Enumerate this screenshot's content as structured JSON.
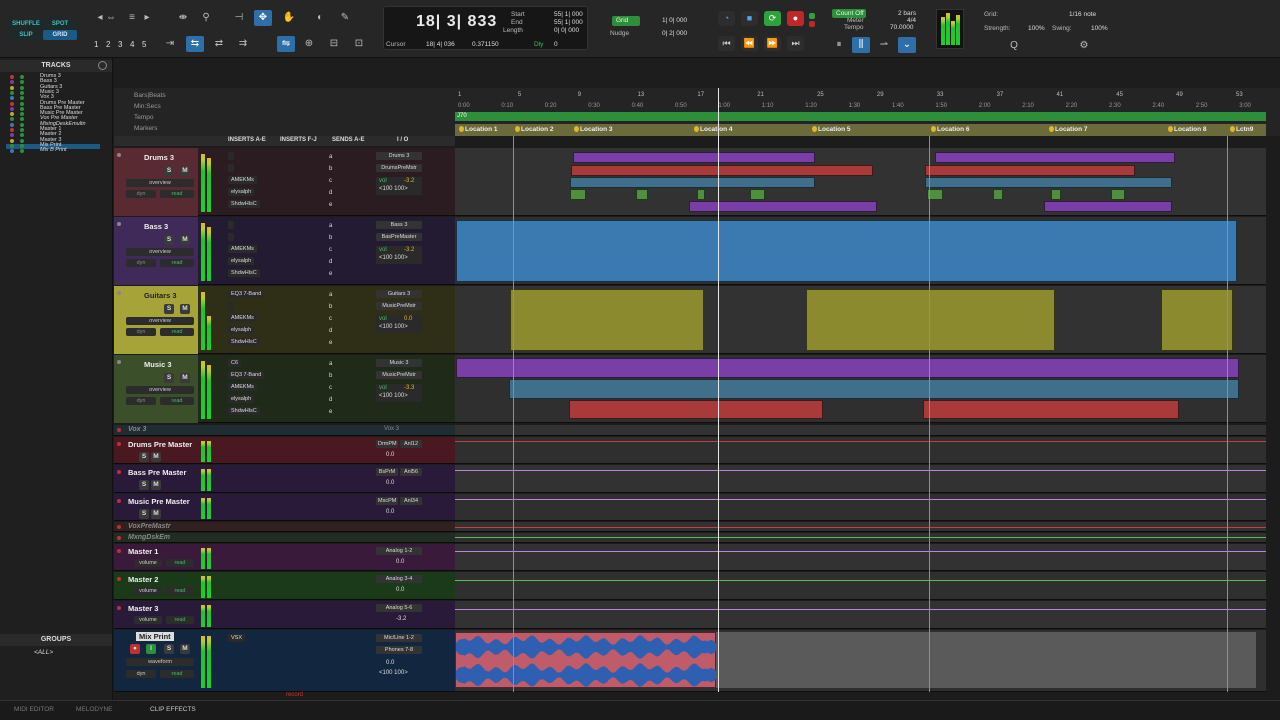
{
  "toolbar": {
    "modes": {
      "shuffle": "SHUFFLE",
      "spot": "SPOT",
      "slip": "SLIP",
      "grid": "GRID"
    },
    "zoom_presets": [
      "1",
      "2",
      "3",
      "4",
      "5"
    ],
    "counter": {
      "main": "18| 3| 833",
      "start_label": "Start",
      "start": "55| 1| 000",
      "end_label": "End",
      "end": "55| 1| 000",
      "length_label": "Length",
      "length": "0| 0| 000",
      "cursor_label": "Cursor",
      "cursor": "18| 4| 036",
      "cursor_time": "0.371150",
      "dly": "Dly",
      "dly_val": "0"
    },
    "grid_label": "Grid",
    "grid_val": "1| 0| 000",
    "nudge_label": "Nudge",
    "nudge_val": "0| 2| 000",
    "countoff": "Count Off",
    "meter": "Meter",
    "tempo": "Tempo",
    "bars": "2 bars",
    "sig": "4/4",
    "tempo_val": "70.0000",
    "grid2_label": "Grid:",
    "grid2_val": "1/16 note",
    "strength_label": "Strength:",
    "strength_val": "100%",
    "swing_label": "Swing:",
    "swing_val": "100%"
  },
  "sidebar": {
    "tracks_title": "TRACKS",
    "tracks": [
      "Drums 3",
      "Bass 3",
      "Guitars 3",
      "Music 3",
      "Vox 3",
      "Drums Pre Master",
      "Bass Pre Master",
      "Music Pre Master",
      "Vox Pre Master",
      "MixingDeskEmultn",
      "Master 1",
      "Master 2",
      "Master 3",
      "Mix Print",
      "Mix B Print"
    ],
    "groups_title": "GROUPS",
    "groups": [
      "<ALL>"
    ]
  },
  "rulers": {
    "labels": [
      "Bars|Beats",
      "Min:Secs",
      "Tempo",
      "Markers"
    ],
    "tempo_val": "J70",
    "bars": [
      "1",
      "5",
      "9",
      "13",
      "17",
      "21",
      "25",
      "29",
      "33",
      "37",
      "41",
      "45",
      "49",
      "53"
    ],
    "secs": [
      "0:00",
      "0:10",
      "0:20",
      "0:30",
      "0:40",
      "0:50",
      "1:00",
      "1:10",
      "1:20",
      "1:30",
      "1:40",
      "1:50",
      "2:00",
      "2:10",
      "2:20",
      "2:30",
      "2:40",
      "2:50",
      "3:00"
    ],
    "locations": [
      "Location 1",
      "Location 2",
      "Location 3",
      "Location 4",
      "Location 5",
      "Location 6",
      "Location 7",
      "Location 8",
      "Lctn9"
    ]
  },
  "columns": {
    "ins_ae": "INSERTS A-E",
    "ins_fj": "INSERTS F-J",
    "sends": "SENDS A-E",
    "io": "I / O"
  },
  "tracks": [
    {
      "name": "Drums 3",
      "inserts": [
        "",
        "",
        "AMEKMs",
        "elysalph",
        "ShdwHlsC"
      ],
      "out": "Drums 3",
      "out2": "DrumsPreMstr",
      "vol": "-3.2",
      "pan": "<100  100>",
      "view": "overview",
      "auto": "read",
      "dyn": "dyn"
    },
    {
      "name": "Bass 3",
      "inserts": [
        "",
        "",
        "AMEKMs",
        "elysalph",
        "ShdwHlsC"
      ],
      "out": "Bass 3",
      "out2": "BasPreMaster",
      "vol": "-3.2",
      "pan": "<100  100>",
      "view": "overview",
      "auto": "read",
      "dyn": "dyn"
    },
    {
      "name": "Guitars 3",
      "inserts": [
        "EQ3 7-Band",
        "",
        "AMEKMs",
        "elysalph",
        "ShdwHlsC"
      ],
      "out": "Guitars 3",
      "out2": "MusicPreMstr",
      "vol": "0.0",
      "pan": "<100  100>",
      "view": "overview",
      "auto": "read",
      "dyn": "dyn"
    },
    {
      "name": "Music 3",
      "inserts": [
        "C6",
        "EQ3 7-Band",
        "AMEKMs",
        "elysalph",
        "ShdwHlsC"
      ],
      "out": "Music 3",
      "out2": "MusicPreMstr",
      "vol": "-3.3",
      "pan": "<100  100>",
      "view": "overview",
      "auto": "read",
      "dyn": "dyn"
    }
  ],
  "aux": [
    {
      "name": "Vox 3",
      "io": "Vox 3"
    },
    {
      "name": "Drums Pre Master",
      "io1": "DrmPM",
      "io2": "Anl12",
      "vol": "0.0"
    },
    {
      "name": "Bass Pre Master",
      "io1": "BsPrM",
      "io2": "Anl56",
      "vol": "0.0"
    },
    {
      "name": "Music Pre Master",
      "io1": "MscPM",
      "io2": "Anl34",
      "vol": "0.0"
    },
    {
      "name": "VoxPreMastr"
    },
    {
      "name": "MxngDskEm"
    },
    {
      "name": "Master 1",
      "io": "Analog 1-2",
      "vol": "0.0",
      "view": "volume",
      "auto": "read"
    },
    {
      "name": "Master 2",
      "io": "Analog 3-4",
      "vol": "0.0",
      "view": "volume",
      "auto": "read"
    },
    {
      "name": "Master 3",
      "io": "Analog 5-6",
      "vol": "-3.2",
      "view": "volume",
      "auto": "read"
    }
  ],
  "mixprint": {
    "name": "Mix Print",
    "insert": "VSX",
    "in": "Mic/Line 1-2",
    "out": "Phones 7-8",
    "vol": "0.0",
    "pan": "<100  100>",
    "view": "waveform",
    "auto": "read",
    "dyn": "dyn",
    "record": "record"
  },
  "status": {
    "midi": "MIDI EDITOR",
    "melodyne": "MELODYNE",
    "clip": "CLIP EFFECTS"
  },
  "colors": {
    "purple": "#7a3fa6",
    "red": "#a83a3a",
    "teal": "#3f6f8a",
    "green": "#4f8f3f",
    "blue": "#3b7ab0",
    "gold": "#8c8a2f",
    "record": "#d03030"
  }
}
